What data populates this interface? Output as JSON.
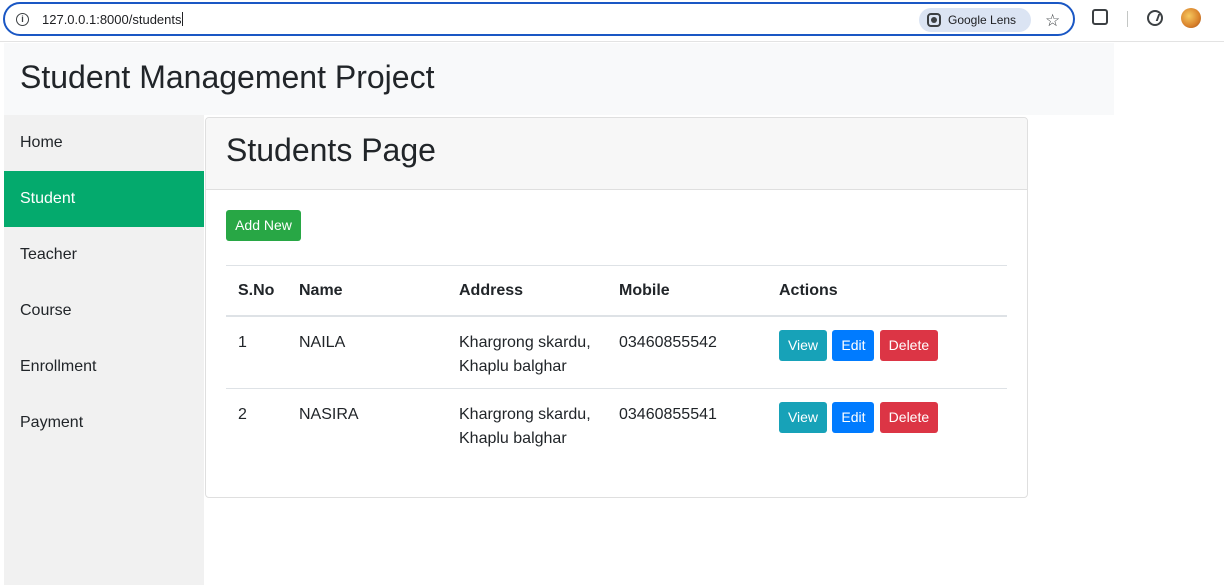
{
  "browser": {
    "url": "127.0.0.1:8000/students",
    "lens_label": "Google Lens"
  },
  "app": {
    "title": "Student Management Project"
  },
  "sidebar": {
    "items": [
      {
        "label": "Home",
        "active": false
      },
      {
        "label": "Student",
        "active": true
      },
      {
        "label": "Teacher",
        "active": false
      },
      {
        "label": "Course",
        "active": false
      },
      {
        "label": "Enrollment",
        "active": false
      },
      {
        "label": "Payment",
        "active": false
      }
    ]
  },
  "page": {
    "title": "Students Page",
    "add_button": "Add New"
  },
  "table": {
    "headers": [
      "S.No",
      "Name",
      "Address",
      "Mobile",
      "Actions"
    ],
    "rows": [
      {
        "sno": "1",
        "name": "NAILA",
        "address": "Khargrong skardu, Khaplu balghar",
        "mobile": "03460855542"
      },
      {
        "sno": "2",
        "name": "NASIRA",
        "address": "Khargrong skardu, Khaplu balghar",
        "mobile": "03460855541"
      }
    ],
    "actions": {
      "view": "View",
      "edit": "Edit",
      "delete": "Delete"
    }
  },
  "colors": {
    "active_nav": "#04aa6d",
    "add_button": "#28a745",
    "view_button": "#17a2b8",
    "edit_button": "#007bff",
    "delete_button": "#dc3545"
  }
}
